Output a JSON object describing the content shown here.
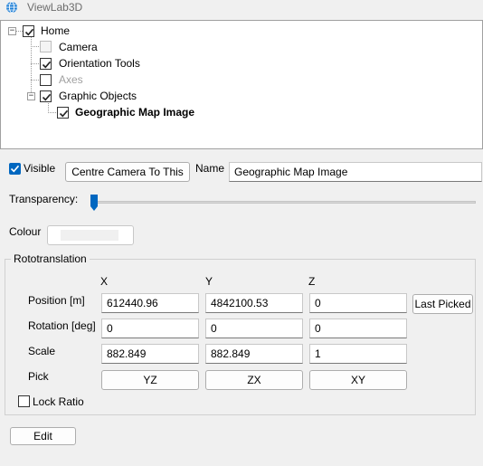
{
  "window": {
    "title": "ViewLab3D",
    "icon": "globe-icon"
  },
  "tree": {
    "nodes": [
      {
        "label": "Home",
        "checked": true,
        "disabled": false,
        "expanded": true
      },
      {
        "label": "Camera",
        "checked": false,
        "disabled": true
      },
      {
        "label": "Orientation Tools",
        "checked": true,
        "disabled": false
      },
      {
        "label": "Axes",
        "checked": false,
        "disabled": true
      },
      {
        "label": "Graphic Objects",
        "checked": true,
        "disabled": false,
        "expanded": true
      },
      {
        "label": "Geographic Map Image",
        "checked": true,
        "disabled": false,
        "selected": true
      }
    ]
  },
  "props": {
    "visible_label": "Visible",
    "visible_checked": true,
    "centre_button": "Centre Camera To This",
    "name_label": "Name",
    "name_value": "Geographic Map Image",
    "transparency_label": "Transparency:",
    "transparency_value": 0,
    "colour_label": "Colour"
  },
  "roto": {
    "title": "Rototranslation",
    "col_x": "X",
    "col_y": "Y",
    "col_z": "Z",
    "position_label": "Position [m]",
    "position": [
      "612440.96",
      "4842100.53",
      "0"
    ],
    "last_picked_button": "Last Picked",
    "rotation_label": "Rotation [deg]",
    "rotation": [
      "0",
      "0",
      "0"
    ],
    "scale_label": "Scale",
    "scale": [
      "882.849",
      "882.849",
      "1"
    ],
    "pick_label": "Pick",
    "pick_buttons": [
      "YZ",
      "ZX",
      "XY"
    ],
    "lock_ratio_label": "Lock Ratio",
    "lock_ratio_checked": false
  },
  "edit_button": "Edit",
  "colors": {
    "accent": "#0067c0",
    "thumb": "#0067c0"
  }
}
